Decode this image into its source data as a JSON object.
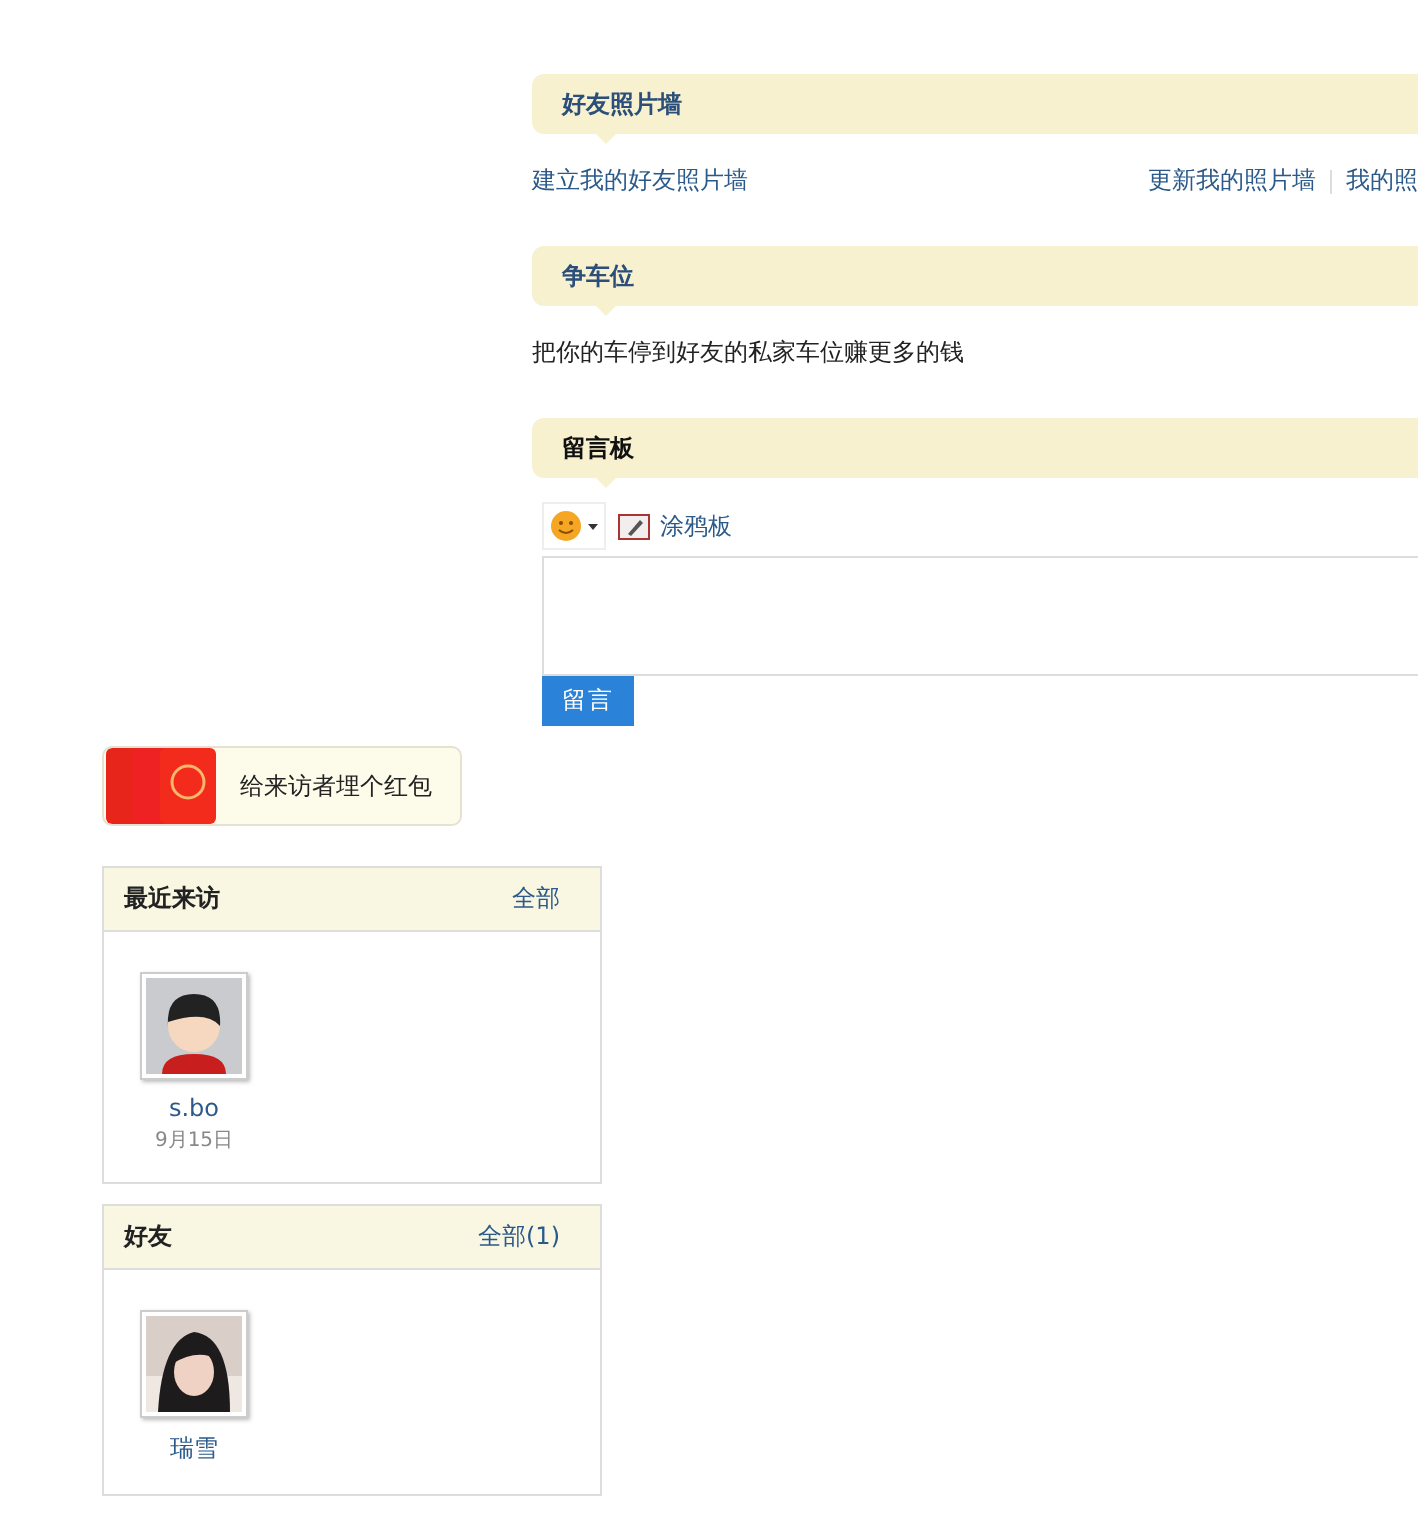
{
  "main": [
    {
      "kind": "links",
      "title": "好友照片墙",
      "linked": true,
      "left_link": "建立我的好友照片墙",
      "right_links": [
        "更新我的照片墙",
        "我的照"
      ]
    },
    {
      "kind": "text",
      "title": "争车位",
      "linked": true,
      "text": "把你的车停到好友的私家车位赚更多的钱"
    },
    {
      "kind": "board",
      "title": "留言板",
      "linked": false,
      "doodle": "涂鸦板",
      "submit": "留言"
    }
  ],
  "sidebar": {
    "promo": "给来访者埋个红包",
    "boxes": [
      {
        "title": "最近来访",
        "more": "全部",
        "people": [
          {
            "name": "s.bo",
            "date": "9月15日",
            "kind": "cartoon"
          }
        ]
      },
      {
        "title": "好友",
        "more": "全部(1)",
        "people": [
          {
            "name": "瑞雪"
          }
        ]
      }
    ]
  }
}
